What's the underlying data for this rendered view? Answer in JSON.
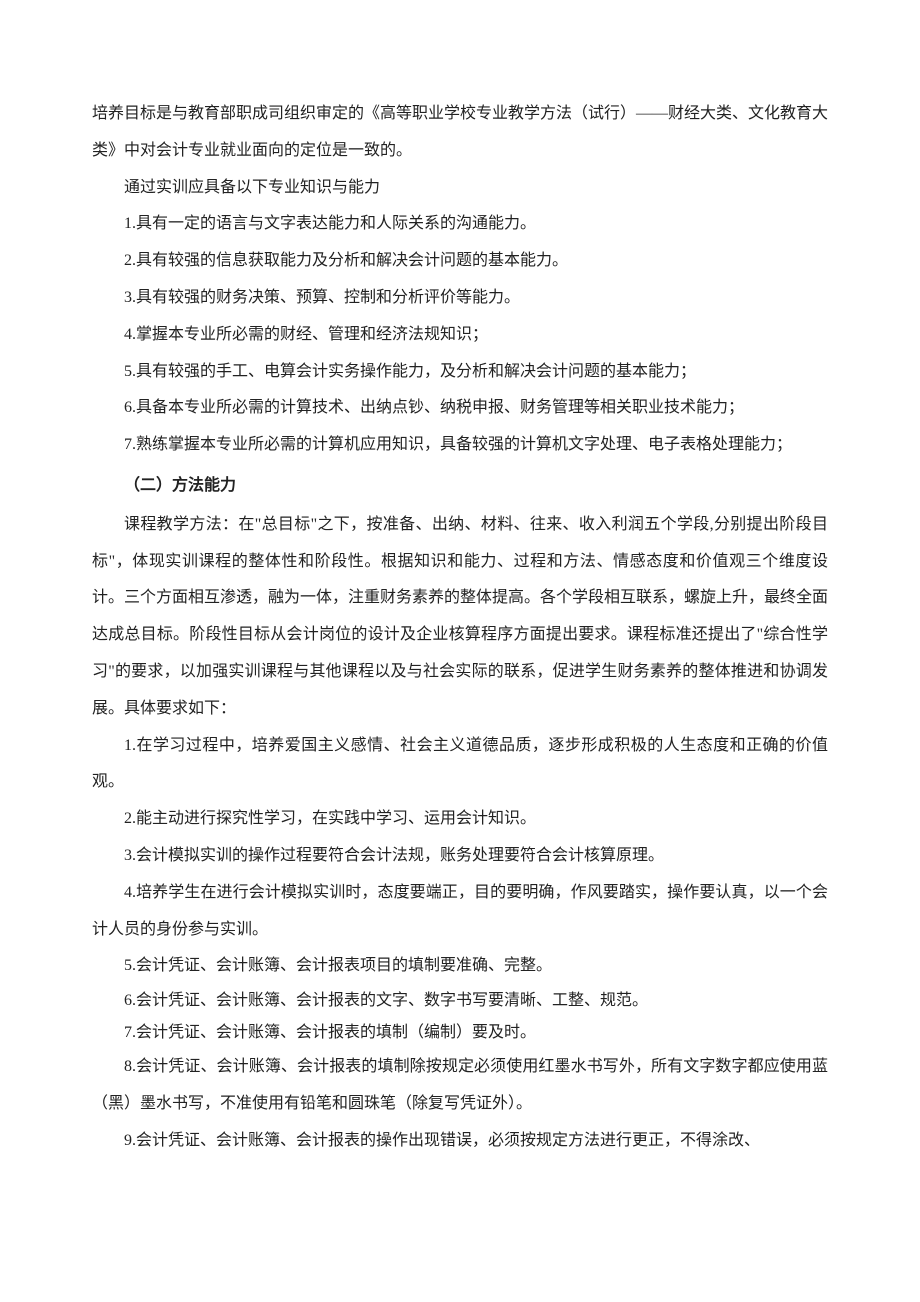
{
  "intro": {
    "p1": "培养目标是与教育部职成司组织审定的《高等职业学校专业教学方法（试行）——财经大类、文化教育大类》中对会计专业就业面向的定位是一致的。",
    "p2": "通过实训应具备以下专业知识与能力",
    "items": [
      "1.具有一定的语言与文字表达能力和人际关系的沟通能力。",
      "2.具有较强的信息获取能力及分析和解决会计问题的基本能力。",
      "3.具有较强的财务决策、预算、控制和分析评价等能力。",
      "4.掌握本专业所必需的财经、管理和经济法规知识；",
      "5.具有较强的手工、电算会计实务操作能力，及分析和解决会计问题的基本能力；",
      "6.具备本专业所必需的计算技术、出纳点钞、纳税申报、财务管理等相关职业技术能力；",
      "7.熟练掌握本专业所必需的计算机应用知识，具备较强的计算机文字处理、电子表格处理能力；"
    ]
  },
  "section2": {
    "title": "（二）方法能力",
    "p1": "课程教学方法：在\"总目标\"之下，按准备、出纳、材料、往来、收入利润五个学段,分别提出阶段目标\"，体现实训课程的整体性和阶段性。根据知识和能力、过程和方法、情感态度和价值观三个维度设计。三个方面相互渗透，融为一体，注重财务素养的整体提高。各个学段相互联系，螺旋上升，最终全面达成总目标。阶段性目标从会计岗位的设计及企业核算程序方面提出要求。课程标准还提出了\"综合性学习\"的要求，以加强实训课程与其他课程以及与社会实际的联系，促进学生财务素养的整体推进和协调发展。具体要求如下：",
    "items_a": [
      "1.在学习过程中，培养爱国主义感情、社会主义道德品质，逐步形成积极的人生态度和正确的价值观。",
      "2.能主动进行探究性学习，在实践中学习、运用会计知识。",
      "3.会计模拟实训的操作过程要符合会计法规，账务处理要符合会计核算原理。",
      "4.培养学生在进行会计模拟实训时，态度要端正，目的要明确，作风要踏实，操作要认真，以一个会计人员的身份参与实训。",
      "5.会计凭证、会计账簿、会计报表项目的填制要准确、完整。"
    ],
    "items_b": [
      "6.会计凭证、会计账簿、会计报表的文字、数字书写要清晰、工整、规范。",
      "7.会计凭证、会计账簿、会计报表的填制（编制）要及时。"
    ],
    "items_c": [
      "8.会计凭证、会计账簿、会计报表的填制除按规定必须使用红墨水书写外，所有文字数字都应使用蓝（黑）墨水书写，不准使用有铅笔和圆珠笔（除复写凭证外）。",
      "9.会计凭证、会计账簿、会计报表的操作出现错误，必须按规定方法进行更正，不得涂改、"
    ]
  }
}
